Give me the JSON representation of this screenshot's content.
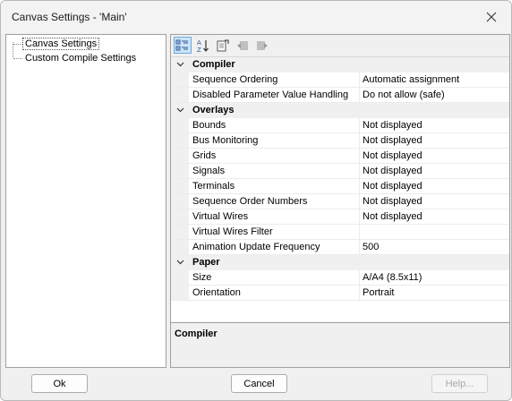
{
  "window": {
    "title": "Canvas Settings - 'Main'"
  },
  "tree": {
    "items": [
      {
        "label": "Canvas Settings"
      },
      {
        "label": "Custom Compile Settings"
      }
    ]
  },
  "toolbar": {
    "buttons": [
      "categorized-icon",
      "alphabetical-icon",
      "property-pages-icon",
      "undo-icon",
      "redo-icon"
    ]
  },
  "grid": {
    "categories": [
      {
        "name": "Compiler",
        "rows": [
          {
            "name": "Sequence Ordering",
            "value": "Automatic assignment"
          },
          {
            "name": "Disabled Parameter Value Handling",
            "value": "Do not allow (safe)"
          }
        ]
      },
      {
        "name": "Overlays",
        "rows": [
          {
            "name": "Bounds",
            "value": "Not displayed"
          },
          {
            "name": "Bus Monitoring",
            "value": "Not displayed"
          },
          {
            "name": "Grids",
            "value": "Not displayed"
          },
          {
            "name": "Signals",
            "value": "Not displayed"
          },
          {
            "name": "Terminals",
            "value": "Not displayed"
          },
          {
            "name": "Sequence Order Numbers",
            "value": "Not displayed"
          },
          {
            "name": "Virtual Wires",
            "value": "Not displayed"
          },
          {
            "name": "Virtual Wires Filter",
            "value": ""
          },
          {
            "name": "Animation Update Frequency",
            "value": "500"
          }
        ]
      },
      {
        "name": "Paper",
        "rows": [
          {
            "name": "Size",
            "value": "A/A4 (8.5x11)"
          },
          {
            "name": "Orientation",
            "value": "Portrait"
          }
        ]
      }
    ]
  },
  "description": {
    "title": "Compiler"
  },
  "buttons": {
    "ok": "Ok",
    "cancel": "Cancel",
    "help": "Help..."
  }
}
